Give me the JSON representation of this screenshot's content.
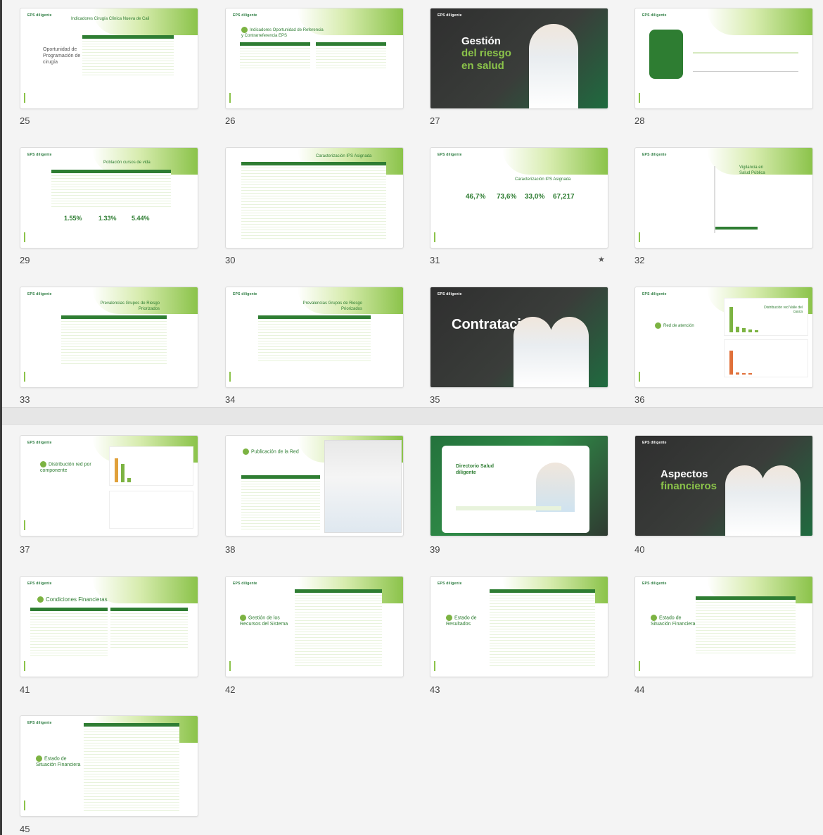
{
  "logo_text": "EPS diligente",
  "colors": {
    "primary_green": "#2e7d32",
    "accent_green": "#8bc34a",
    "dark_bg": "#2f2f2f"
  },
  "slides": [
    {
      "n": "25",
      "title": "Indicadores Cirugía Clínica Nueva de Cali",
      "sub": "Oportunidad de Programación de cirugía"
    },
    {
      "n": "26",
      "title": "Indicadores Oportunidad de Referencia y Contrarreferencia EPS",
      "sub": ""
    },
    {
      "n": "27",
      "title_a": "Gestión",
      "title_b": "del riesgo",
      "title_c": "en salud"
    },
    {
      "n": "28",
      "title": "",
      "sub": ""
    },
    {
      "n": "29",
      "title": "Población cursos de vida",
      "stats": [
        "1.55%",
        "1.33%",
        "5.44%"
      ]
    },
    {
      "n": "30",
      "title": "Caracterización IPS Asignada",
      "sub": ""
    },
    {
      "n": "31",
      "title": "Caracterización IPS Asignada",
      "stats": [
        "46,7%",
        "73,6%",
        "33,0%",
        "67,217"
      ]
    },
    {
      "n": "32",
      "title": "Vigilancia en Salud Pública",
      "sub": ""
    },
    {
      "n": "33",
      "title": "Prevalencias Grupos de Riesgo Priorizados",
      "sub": ""
    },
    {
      "n": "34",
      "title": "Prevalencias Grupos de Riesgo Priorizados",
      "sub": ""
    },
    {
      "n": "35",
      "title": "Contratación"
    },
    {
      "n": "36",
      "title": "Red de atención",
      "sub": "Distribución red Valle del cauca"
    },
    {
      "n": "37",
      "title": "Distribución red por componente",
      "sub": ""
    },
    {
      "n": "38",
      "title": "Publicación de la Red",
      "sub": ""
    },
    {
      "n": "39",
      "title": "Directorio Salud diligente",
      "sub": ""
    },
    {
      "n": "40",
      "title_a": "Aspectos",
      "title_b": "financieros"
    },
    {
      "n": "41",
      "title": "Condiciones Financieras",
      "sub": ""
    },
    {
      "n": "42",
      "title": "Gestión de los Recursos del Sistema",
      "sub": ""
    },
    {
      "n": "43",
      "title": "Estado de Resultados",
      "sub": ""
    },
    {
      "n": "44",
      "title": "Estado de Situación Financiera",
      "sub": ""
    },
    {
      "n": "45",
      "title": "Estado de Situación Financiera",
      "sub": ""
    }
  ]
}
